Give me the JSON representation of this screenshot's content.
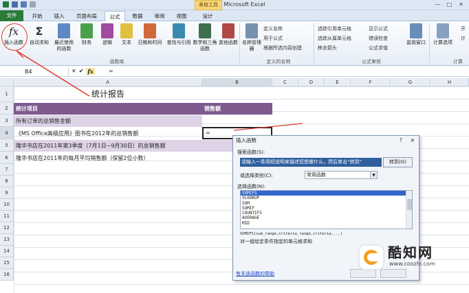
{
  "window": {
    "title": "Excel - Microsoft Excel",
    "context_tab": "表格工具",
    "minimize": "—",
    "maximize": "□",
    "close": "✕"
  },
  "tabs": [
    {
      "label": "文件"
    },
    {
      "label": "开始"
    },
    {
      "label": "插入"
    },
    {
      "label": "页面布局"
    },
    {
      "label": "公式"
    },
    {
      "label": "数据"
    },
    {
      "label": "审阅"
    },
    {
      "label": "视图"
    },
    {
      "label": "设计"
    }
  ],
  "ribbon": {
    "buttons": [
      {
        "label": "插入函数"
      },
      {
        "label": "自动求和"
      },
      {
        "label": "最近使用的函数"
      },
      {
        "label": "财务"
      },
      {
        "label": "逻辑"
      },
      {
        "label": "文本"
      },
      {
        "label": "日期和时间"
      },
      {
        "label": "查找与引用"
      },
      {
        "label": "数学和三角函数"
      },
      {
        "label": "其他函数"
      },
      {
        "label": "名称管理器"
      },
      {
        "label": "监视窗口"
      },
      {
        "label": "计算选项"
      }
    ],
    "small": [
      "定义名称",
      "用于公式",
      "根据所选内容创建",
      "追踪引用单元格",
      "追踪从属单元格",
      "移去箭头",
      "显示公式",
      "错误检查",
      "公式求值"
    ],
    "groups": {
      "library": "函数库",
      "names": "定义的名称",
      "audit": "公式审核",
      "calc": "计算"
    },
    "right_cut": [
      "开",
      "计"
    ],
    "fx_symbol": "fx",
    "sigma_symbol": "Σ"
  },
  "formula_bar": {
    "namebox": "B4",
    "cancel": "✕",
    "enter": "✔",
    "fx": "fx",
    "value": "="
  },
  "columns": [
    "A",
    "B",
    "C",
    "D",
    "E",
    "F",
    "G",
    "H"
  ],
  "rows": [
    "1",
    "2",
    "3",
    "4",
    "5",
    "6",
    "7",
    "8",
    "9",
    "10",
    "11",
    "12",
    "13",
    "14",
    "15",
    "16"
  ],
  "sheet": {
    "title": "统计报告",
    "header_item": "统计项目",
    "header_sales": "销售额",
    "r3": "所有订单的总销售金额",
    "r4": "《MS Office高级应用》图书在2012年的总销售额",
    "r4b": "=",
    "r5": "隆华书店在2011年第3季度（7月1日~9月30日）的总销售额",
    "r6": "隆华书店在2011年的每月平均销售额（保留2位小数）"
  },
  "dialog": {
    "title": "插入函数",
    "help": "?",
    "close": "✕",
    "search_label": "搜索函数(S):",
    "search_value": "请输入一条简短说明来描述您想做什么，然后单击“转到”",
    "go": "转到(G)",
    "category_label": "或选择类别(C):",
    "category_value": "常用函数",
    "list_label": "选择函数(N):",
    "functions": [
      "SUMIFS",
      "VLOOKUP",
      "SUM",
      "SUMIF",
      "COUNTIFS",
      "AVERAGE",
      "MID"
    ],
    "signature": "SUMIFS(sum_range,criteria_range,criteria,...)",
    "description": "对一组给定条件指定的单元格求和",
    "help_link": "有关该函数的帮助"
  },
  "watermark": {
    "name": "酷知网",
    "url": "www.coozhi.com"
  },
  "colors": {
    "purple": "#7e5a8f",
    "lavender": "#ddd2e6",
    "file_tab": "#2a7a3a",
    "annotation": "#e0392b"
  }
}
